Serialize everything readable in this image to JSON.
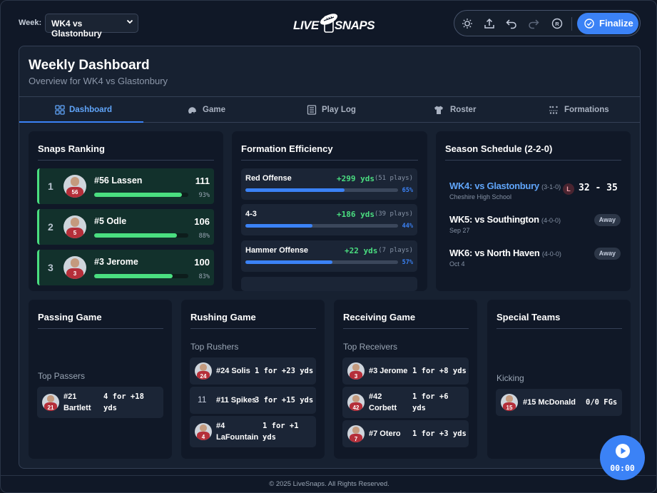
{
  "header": {
    "week_label": "Week:",
    "week_selected": "WK4 vs Glastonbury",
    "logo_left": "LIVE",
    "logo_right": "SNAPS",
    "toolbar_icons": [
      "sun-icon",
      "upload-icon",
      "undo-icon",
      "redo-icon",
      "registered-icon"
    ],
    "finalize_label": "Finalize"
  },
  "page": {
    "title": "Weekly Dashboard",
    "subtitle": "Overview for WK4 vs Glastonbury"
  },
  "tabs": [
    {
      "label": "Dashboard",
      "icon": "dashboard-icon",
      "active": true
    },
    {
      "label": "Game",
      "icon": "helmet-icon",
      "active": false
    },
    {
      "label": "Play Log",
      "icon": "list-icon",
      "active": false
    },
    {
      "label": "Roster",
      "icon": "jersey-icon",
      "active": false
    },
    {
      "label": "Formations",
      "icon": "formation-icon",
      "active": false
    }
  ],
  "snaps_ranking": {
    "title": "Snaps Ranking",
    "rows": [
      {
        "rank": "1",
        "name": "#56 Lassen",
        "snaps": "111",
        "pct_label": "93%",
        "pct": 93,
        "jersey": "56"
      },
      {
        "rank": "2",
        "name": "#5 Odle",
        "snaps": "106",
        "pct_label": "88%",
        "pct": 88,
        "jersey": "5"
      },
      {
        "rank": "3",
        "name": "#3 Jerome",
        "snaps": "100",
        "pct_label": "83%",
        "pct": 83,
        "jersey": "3"
      }
    ]
  },
  "formation_efficiency": {
    "title": "Formation Efficiency",
    "rows": [
      {
        "name": "Red Offense",
        "yds": "+299 yds",
        "plays": "(51 plays)",
        "pct_label": "65%",
        "pct": 65
      },
      {
        "name": "4-3",
        "yds": "+186 yds",
        "plays": "(39 plays)",
        "pct_label": "44%",
        "pct": 44
      },
      {
        "name": "Hammer Offense",
        "yds": "+22 yds",
        "plays": "(7 plays)",
        "pct_label": "57%",
        "pct": 57
      }
    ]
  },
  "season_schedule": {
    "title": "Season Schedule (2-2-0)",
    "games": [
      {
        "opponent": "WK4: vs Glastonbury",
        "record": "(3-1-0)",
        "sub": "Cheshire High School",
        "result": "L",
        "score": "32 - 35",
        "current": true
      },
      {
        "opponent": "WK5: vs Southington",
        "record": "(4-0-0)",
        "sub": "Sep 27",
        "badge": "Away"
      },
      {
        "opponent": "WK6: vs North Haven",
        "record": "(4-0-0)",
        "sub": "Oct 4",
        "badge": "Away"
      }
    ]
  },
  "passing_game": {
    "title": "Passing Game",
    "section_label": "Top Passers",
    "players": [
      {
        "name_line1": "#21",
        "name_line2": "Bartlett",
        "stat_line1": "4 for +18",
        "stat_line2": "yds",
        "jersey": "21"
      }
    ]
  },
  "rushing_game": {
    "title": "Rushing Game",
    "section_label": "Top Rushers",
    "players": [
      {
        "name": "#24 Solis",
        "stat": "1 for +23 yds",
        "jersey": "24"
      },
      {
        "number": "11",
        "name": "#11 Spikes",
        "stat": "3 for +15 yds"
      },
      {
        "name_line1": "#4",
        "name_line2": "LaFountain",
        "stat_line1": "1 for +1",
        "stat_line2": "yds",
        "jersey": "4"
      }
    ]
  },
  "receiving_game": {
    "title": "Receiving Game",
    "section_label": "Top Receivers",
    "players": [
      {
        "name": "#3 Jerome",
        "stat": "1 for +8 yds",
        "jersey": "3"
      },
      {
        "name_line1": "#42",
        "name_line2": "Corbett",
        "stat_line1": "1 for +6",
        "stat_line2": "yds",
        "jersey": "42"
      },
      {
        "name": "#7 Otero",
        "stat": "1 for +3 yds",
        "jersey": "7"
      }
    ]
  },
  "special_teams": {
    "title": "Special Teams",
    "section_label": "Kicking",
    "players": [
      {
        "name": "#15 McDonald",
        "stat": "0/0 FGs",
        "jersey": "15"
      }
    ]
  },
  "record_button": {
    "time": "00:00",
    "icon": "play-icon"
  },
  "footer": {
    "text": "© 2025 LiveSnaps. All Rights Reserved."
  }
}
